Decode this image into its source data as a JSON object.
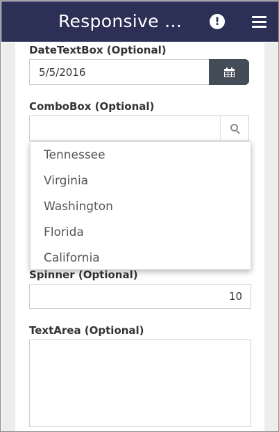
{
  "header": {
    "title": "Responsive …",
    "alert_icon": "exclamation-icon",
    "menu_icon": "hamburger-menu-icon",
    "background": "#2c2f56"
  },
  "date_field": {
    "label": "DateTextBox (Optional)",
    "value": "5/5/2016",
    "button_icon": "calendar-icon"
  },
  "combo_field": {
    "label": "ComboBox (Optional)",
    "value": "",
    "search_icon": "search-icon",
    "options": [
      "Tennessee",
      "Virginia",
      "Washington",
      "Florida",
      "California"
    ]
  },
  "spinner_field": {
    "label": "Spinner (Optional)",
    "value": "10"
  },
  "textarea_field": {
    "label": "TextArea (Optional)",
    "value": ""
  }
}
